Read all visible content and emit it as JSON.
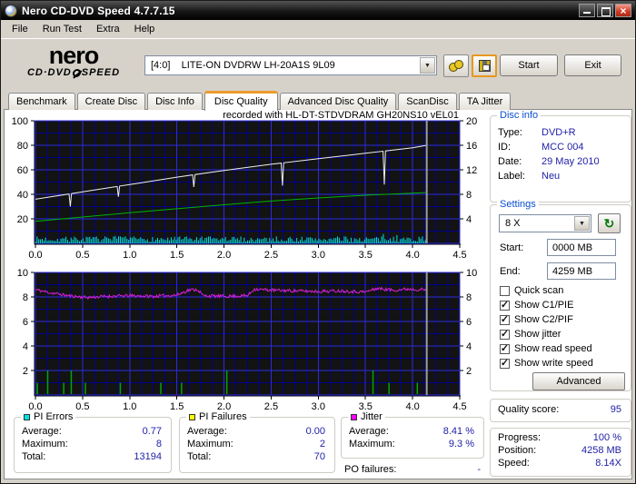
{
  "window": {
    "title": "Nero CD-DVD Speed 4.7.7.15"
  },
  "menu": {
    "items": [
      {
        "label": "File"
      },
      {
        "label": "Run Test"
      },
      {
        "label": "Extra"
      },
      {
        "label": "Help"
      }
    ]
  },
  "toolbar": {
    "logo_top": "nero",
    "logo_bottom_left": "CD·DVD",
    "logo_bottom_right": "SPEED",
    "drive_selector": "[4:0]    LITE-ON DVDRW LH-20A1S 9L09",
    "dropdown_glyph": "▼",
    "start_label": "Start",
    "exit_label": "Exit"
  },
  "tabs": {
    "items": [
      {
        "label": "Benchmark"
      },
      {
        "label": "Create Disc"
      },
      {
        "label": "Disc Info"
      },
      {
        "label": "Disc Quality"
      },
      {
        "label": "Advanced Disc Quality"
      },
      {
        "label": "ScanDisc"
      },
      {
        "label": "TA Jitter"
      }
    ],
    "active_index": 3
  },
  "recorded_with": "recorded with HL-DT-STDVDRAM GH20NS10  vEL01",
  "chart_data": [
    {
      "type": "line",
      "title": "recorded with HL-DT-STDVDRAM GH20NS10  vEL01",
      "x_unit": "GB",
      "xlim": [
        0,
        4.5
      ],
      "x_major": 0.5,
      "x_minor": 0.125,
      "x_tick_labels": [
        "0.0",
        "0.5",
        "1.0",
        "1.5",
        "2.0",
        "2.5",
        "3.0",
        "3.5",
        "4.0",
        "4.5"
      ],
      "left_axis": {
        "lim": [
          0,
          100
        ],
        "ticks": [
          20,
          40,
          60,
          80,
          100
        ],
        "minor": 10
      },
      "right_axis": {
        "lim": [
          0,
          20
        ],
        "ticks": [
          4,
          8,
          12,
          16,
          20
        ]
      },
      "grid": true,
      "end_of_data_x": 4.15,
      "series": [
        {
          "name": "PI Errors (scaled)",
          "kind": "noise-bars",
          "axis": "left",
          "color": "#00e5e5",
          "x_end": 4.15,
          "base": 1.2,
          "amp": 4.5,
          "spike_chance": 0.05,
          "spike_amp": 3.2,
          "seed": 7
        },
        {
          "name": "write speed (X)",
          "kind": "line",
          "axis": "right",
          "color": "#00b400",
          "anchors": [
            [
              0,
              3.6
            ],
            [
              0.5,
              4.3
            ],
            [
              1.0,
              5.0
            ],
            [
              1.5,
              5.65
            ],
            [
              2.0,
              6.3
            ],
            [
              2.5,
              6.9
            ],
            [
              3.0,
              7.4
            ],
            [
              3.5,
              7.85
            ],
            [
              4.0,
              8.2
            ],
            [
              4.15,
              8.3
            ]
          ]
        },
        {
          "name": "read speed (X)",
          "kind": "line",
          "axis": "right",
          "color": "#efefef",
          "anchors": [
            [
              0,
              7.2
            ],
            [
              0.5,
              8.4
            ],
            [
              1.0,
              9.6
            ],
            [
              1.5,
              10.8
            ],
            [
              2.0,
              11.9
            ],
            [
              2.5,
              12.9
            ],
            [
              3.0,
              13.8
            ],
            [
              3.5,
              14.7
            ],
            [
              4.0,
              15.6
            ],
            [
              4.15,
              16.0
            ]
          ],
          "dips": [
            {
              "x": 0.37,
              "v": 6.0
            },
            {
              "x": 0.88,
              "v": 7.6
            },
            {
              "x": 1.68,
              "v": 9.2
            },
            {
              "x": 2.62,
              "v": 9.4
            },
            {
              "x": 3.7,
              "v": 9.6
            }
          ]
        }
      ]
    },
    {
      "type": "line",
      "title": "jitter and PI failures",
      "x_unit": "GB",
      "xlim": [
        0,
        4.5
      ],
      "x_major": 0.5,
      "x_minor": 0.125,
      "x_tick_labels": [
        "0.0",
        "0.5",
        "1.0",
        "1.5",
        "2.0",
        "2.5",
        "3.0",
        "3.5",
        "4.0",
        "4.5"
      ],
      "left_axis": {
        "lim": [
          0,
          10
        ],
        "ticks": [
          2,
          4,
          6,
          8,
          10
        ],
        "minor": 1
      },
      "right_axis": {
        "lim": [
          0,
          10
        ],
        "ticks": [
          2,
          4,
          6,
          8,
          10
        ]
      },
      "grid": true,
      "end_of_data_x": 4.15,
      "series": [
        {
          "name": "PI Failures",
          "kind": "spikes",
          "axis": "left",
          "color": "#00a800",
          "points": [
            [
              0.02,
              1
            ],
            [
              0.13,
              2
            ],
            [
              0.3,
              1
            ],
            [
              0.38,
              2
            ],
            [
              0.53,
              1
            ],
            [
              0.9,
              1
            ],
            [
              1.33,
              1
            ],
            [
              1.55,
              1
            ],
            [
              2.03,
              2
            ],
            [
              3.58,
              2
            ],
            [
              3.75,
              1
            ],
            [
              4.05,
              1
            ]
          ]
        },
        {
          "name": "jitter (%)",
          "kind": "line",
          "axis": "left",
          "color": "#d41ed4",
          "noise": 0.13,
          "noise_step": 0.009,
          "seed": 11,
          "anchors": [
            [
              0,
              8.6
            ],
            [
              0.15,
              8.35
            ],
            [
              0.35,
              8.1
            ],
            [
              0.55,
              7.95
            ],
            [
              0.75,
              8.05
            ],
            [
              1.0,
              8.1
            ],
            [
              1.25,
              8.05
            ],
            [
              1.5,
              8.15
            ],
            [
              1.62,
              8.55
            ],
            [
              1.72,
              8.6
            ],
            [
              1.78,
              8.1
            ],
            [
              2.0,
              8.05
            ],
            [
              2.25,
              8.1
            ],
            [
              2.32,
              8.65
            ],
            [
              2.5,
              8.55
            ],
            [
              2.75,
              8.5
            ],
            [
              3.0,
              8.45
            ],
            [
              3.25,
              8.5
            ],
            [
              3.5,
              8.4
            ],
            [
              3.62,
              8.7
            ],
            [
              3.8,
              8.55
            ],
            [
              3.95,
              8.65
            ],
            [
              4.1,
              8.6
            ],
            [
              4.15,
              8.55
            ]
          ]
        }
      ]
    }
  ],
  "disc_info": {
    "title": "Disc info",
    "rows": [
      {
        "label": "Type:",
        "value": "DVD+R"
      },
      {
        "label": "ID:",
        "value": "MCC 004"
      },
      {
        "label": "Date:",
        "value": "29 May 2010"
      },
      {
        "label": "Label:",
        "value": "Neu"
      }
    ]
  },
  "settings": {
    "title": "Settings",
    "speed_value": "8 X",
    "dropdown_glyph": "▼",
    "refresh_glyph": "↻",
    "start_label": "Start:",
    "start_value": "0000 MB",
    "end_label": "End:",
    "end_value": "4259 MB",
    "checkboxes": [
      {
        "label": "Quick scan",
        "checked": false
      },
      {
        "label": "Show C1/PIE",
        "checked": true
      },
      {
        "label": "Show C2/PIF",
        "checked": true
      },
      {
        "label": "Show jitter",
        "checked": true
      },
      {
        "label": "Show read speed",
        "checked": true
      },
      {
        "label": "Show write speed",
        "checked": true
      }
    ],
    "advanced_label": "Advanced"
  },
  "quality": {
    "label": "Quality score:",
    "value": "95"
  },
  "progress": {
    "rows": [
      {
        "label": "Progress:",
        "value": "100 %"
      },
      {
        "label": "Position:",
        "value": "4258 MB"
      },
      {
        "label": "Speed:",
        "value": "8.14X"
      }
    ]
  },
  "stats": {
    "pi_errors": {
      "title": "PI Errors",
      "color": "#00e5e5",
      "rows": [
        {
          "label": "Average:",
          "value": "0.77"
        },
        {
          "label": "Maximum:",
          "value": "8"
        },
        {
          "label": "Total:",
          "value": "13194"
        }
      ]
    },
    "pi_failures": {
      "title": "PI Failures",
      "color": "#ffff00",
      "rows": [
        {
          "label": "Average:",
          "value": "0.00"
        },
        {
          "label": "Maximum:",
          "value": "2"
        },
        {
          "label": "Total:",
          "value": "70"
        }
      ]
    },
    "jitter": {
      "title": "Jitter",
      "color": "#ff00ff",
      "rows": [
        {
          "label": "Average:",
          "value": "8.41 %"
        },
        {
          "label": "Maximum:",
          "value": "9.3 %"
        }
      ]
    },
    "po_failures": {
      "label": "PO failures:",
      "value": "-"
    }
  }
}
